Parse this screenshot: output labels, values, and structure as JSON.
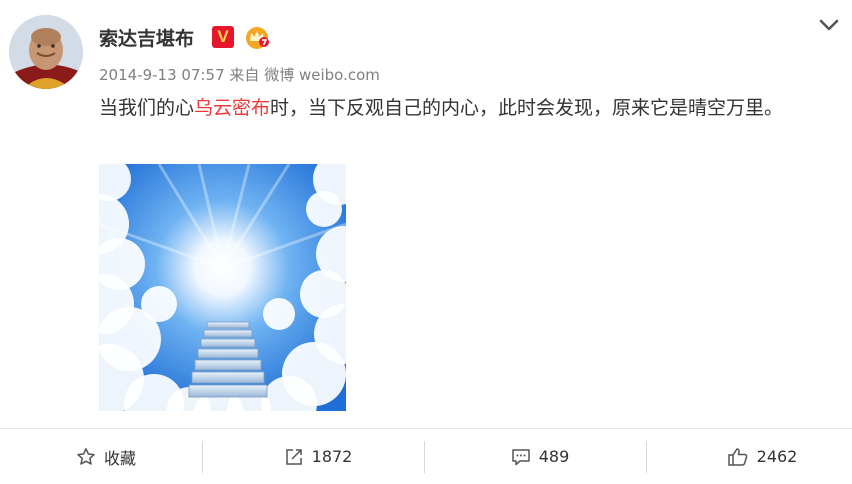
{
  "post": {
    "author": "索达吉堪布",
    "timestamp": "2014-9-13 07:57",
    "source_prefix": "来自",
    "source": "微博 weibo.com",
    "text_before": "当我们的心",
    "text_highlight": "乌云密布",
    "text_after": "时，当下反观自己的内心，此时会发现，原来它是晴空万里。",
    "highlight_color": "#eb3a39"
  },
  "badges": {
    "verified": "V"
  },
  "actions": {
    "favorite": {
      "label": "收藏",
      "icon": "star-icon"
    },
    "repost": {
      "label": "1872",
      "icon": "share-icon"
    },
    "comment": {
      "label": "489",
      "icon": "comment-icon"
    },
    "like": {
      "label": "2462",
      "icon": "thumbs-up-icon"
    }
  }
}
